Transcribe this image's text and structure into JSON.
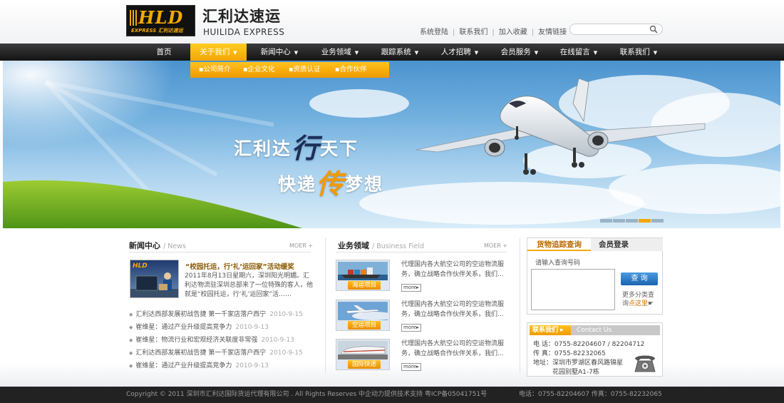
{
  "brand": {
    "logo_text": "HLD",
    "logo_sub": "EXPRESS 汇利达速运",
    "name_cn": "汇利达速运",
    "name_en": "HUILIDA EXPRESS"
  },
  "top_links": [
    "系统登陆",
    "联系我们",
    "加入收藏",
    "友情链接"
  ],
  "search": {
    "placeholder": ""
  },
  "nav": [
    "首页",
    "关于我们",
    "新闻中心",
    "业务领域",
    "跟踪系统",
    "人才招聘",
    "会员服务",
    "在线留言",
    "联系我们"
  ],
  "nav_active_index": 1,
  "subnav": [
    "公司简介",
    "企业文化",
    "资质认证",
    "合作伙伴"
  ],
  "banner": {
    "line1_a": "汇利达",
    "line1_big": "行",
    "line1_b": "天下",
    "line2_a": "快递",
    "line2_big": "传",
    "line2_b": "梦想",
    "slides": 5,
    "active_slide": 3
  },
  "news": {
    "title": "新闻中心",
    "title_en": "/ News",
    "more": "MOER",
    "image_logo": "HLD",
    "headline": "“校园托运，行‘礼’运回家”活动缓奖",
    "body": "2011年8月13日星期六，深圳阳光明媚。汇利达物流驻深圳总部来了一位特殊的客人，他就是“校园托运，行‘礼’运回家”活……",
    "items": [
      {
        "text": "汇利达西部发展初战告捷 第一千家店落户西宁",
        "date": "2010-9-15"
      },
      {
        "text": "崔维星：通过产业升级提高竞争力",
        "date": "2010-9-13"
      },
      {
        "text": "崔维星：物流行业和宏观经济关联度非常强",
        "date": "2010-9-13"
      },
      {
        "text": "汇利达西部发展初战告捷 第一千家店落户西宁",
        "date": "2010-9-15"
      },
      {
        "text": "崔维星：通过产业升级提高竞争力",
        "date": "2010-9-13"
      }
    ]
  },
  "business": {
    "title": "业务领域",
    "title_en": "/ Business Field",
    "more": "MOER",
    "more_btn": "more",
    "items": [
      {
        "label": "海运项目",
        "desc": "代理国内各大航空公司的空运物流服务，确立战略合作伙伴关系，我们..."
      },
      {
        "label": "空运项目",
        "desc": "代理国内各大航空公司的空运物流服务，确立战略合作伙伴关系，我们..."
      },
      {
        "label": "国际快递",
        "desc": "代理国内各大航空公司的空运物流服务，确立战略合作伙伴关系，我们..."
      }
    ]
  },
  "tracking": {
    "tab_active": "货物追踪查询",
    "tab_other": "会员登录",
    "hint": "请输入查询号码",
    "button": "查 询",
    "more_text": "更多分类查",
    "more_text2": "询",
    "more_link": "点这里"
  },
  "contact": {
    "title": "联系我们",
    "title_en": "Contact Us",
    "phone": "电 话：0755-82204607  /  82204712",
    "fax": "传 真：0755-82232065",
    "address1": "地址：深圳市罗湖区春风路锦星",
    "address2": "花园别墅A1-7栋"
  },
  "footer": {
    "copyright": "Copyright © 2011 深圳市汇利达国际货运代理有限公司 . All Rights Reserves    中企动力提供技术支持    粤ICP备05041751号",
    "contact": "电话：0755-82204607    传真：0755-82232065"
  }
}
